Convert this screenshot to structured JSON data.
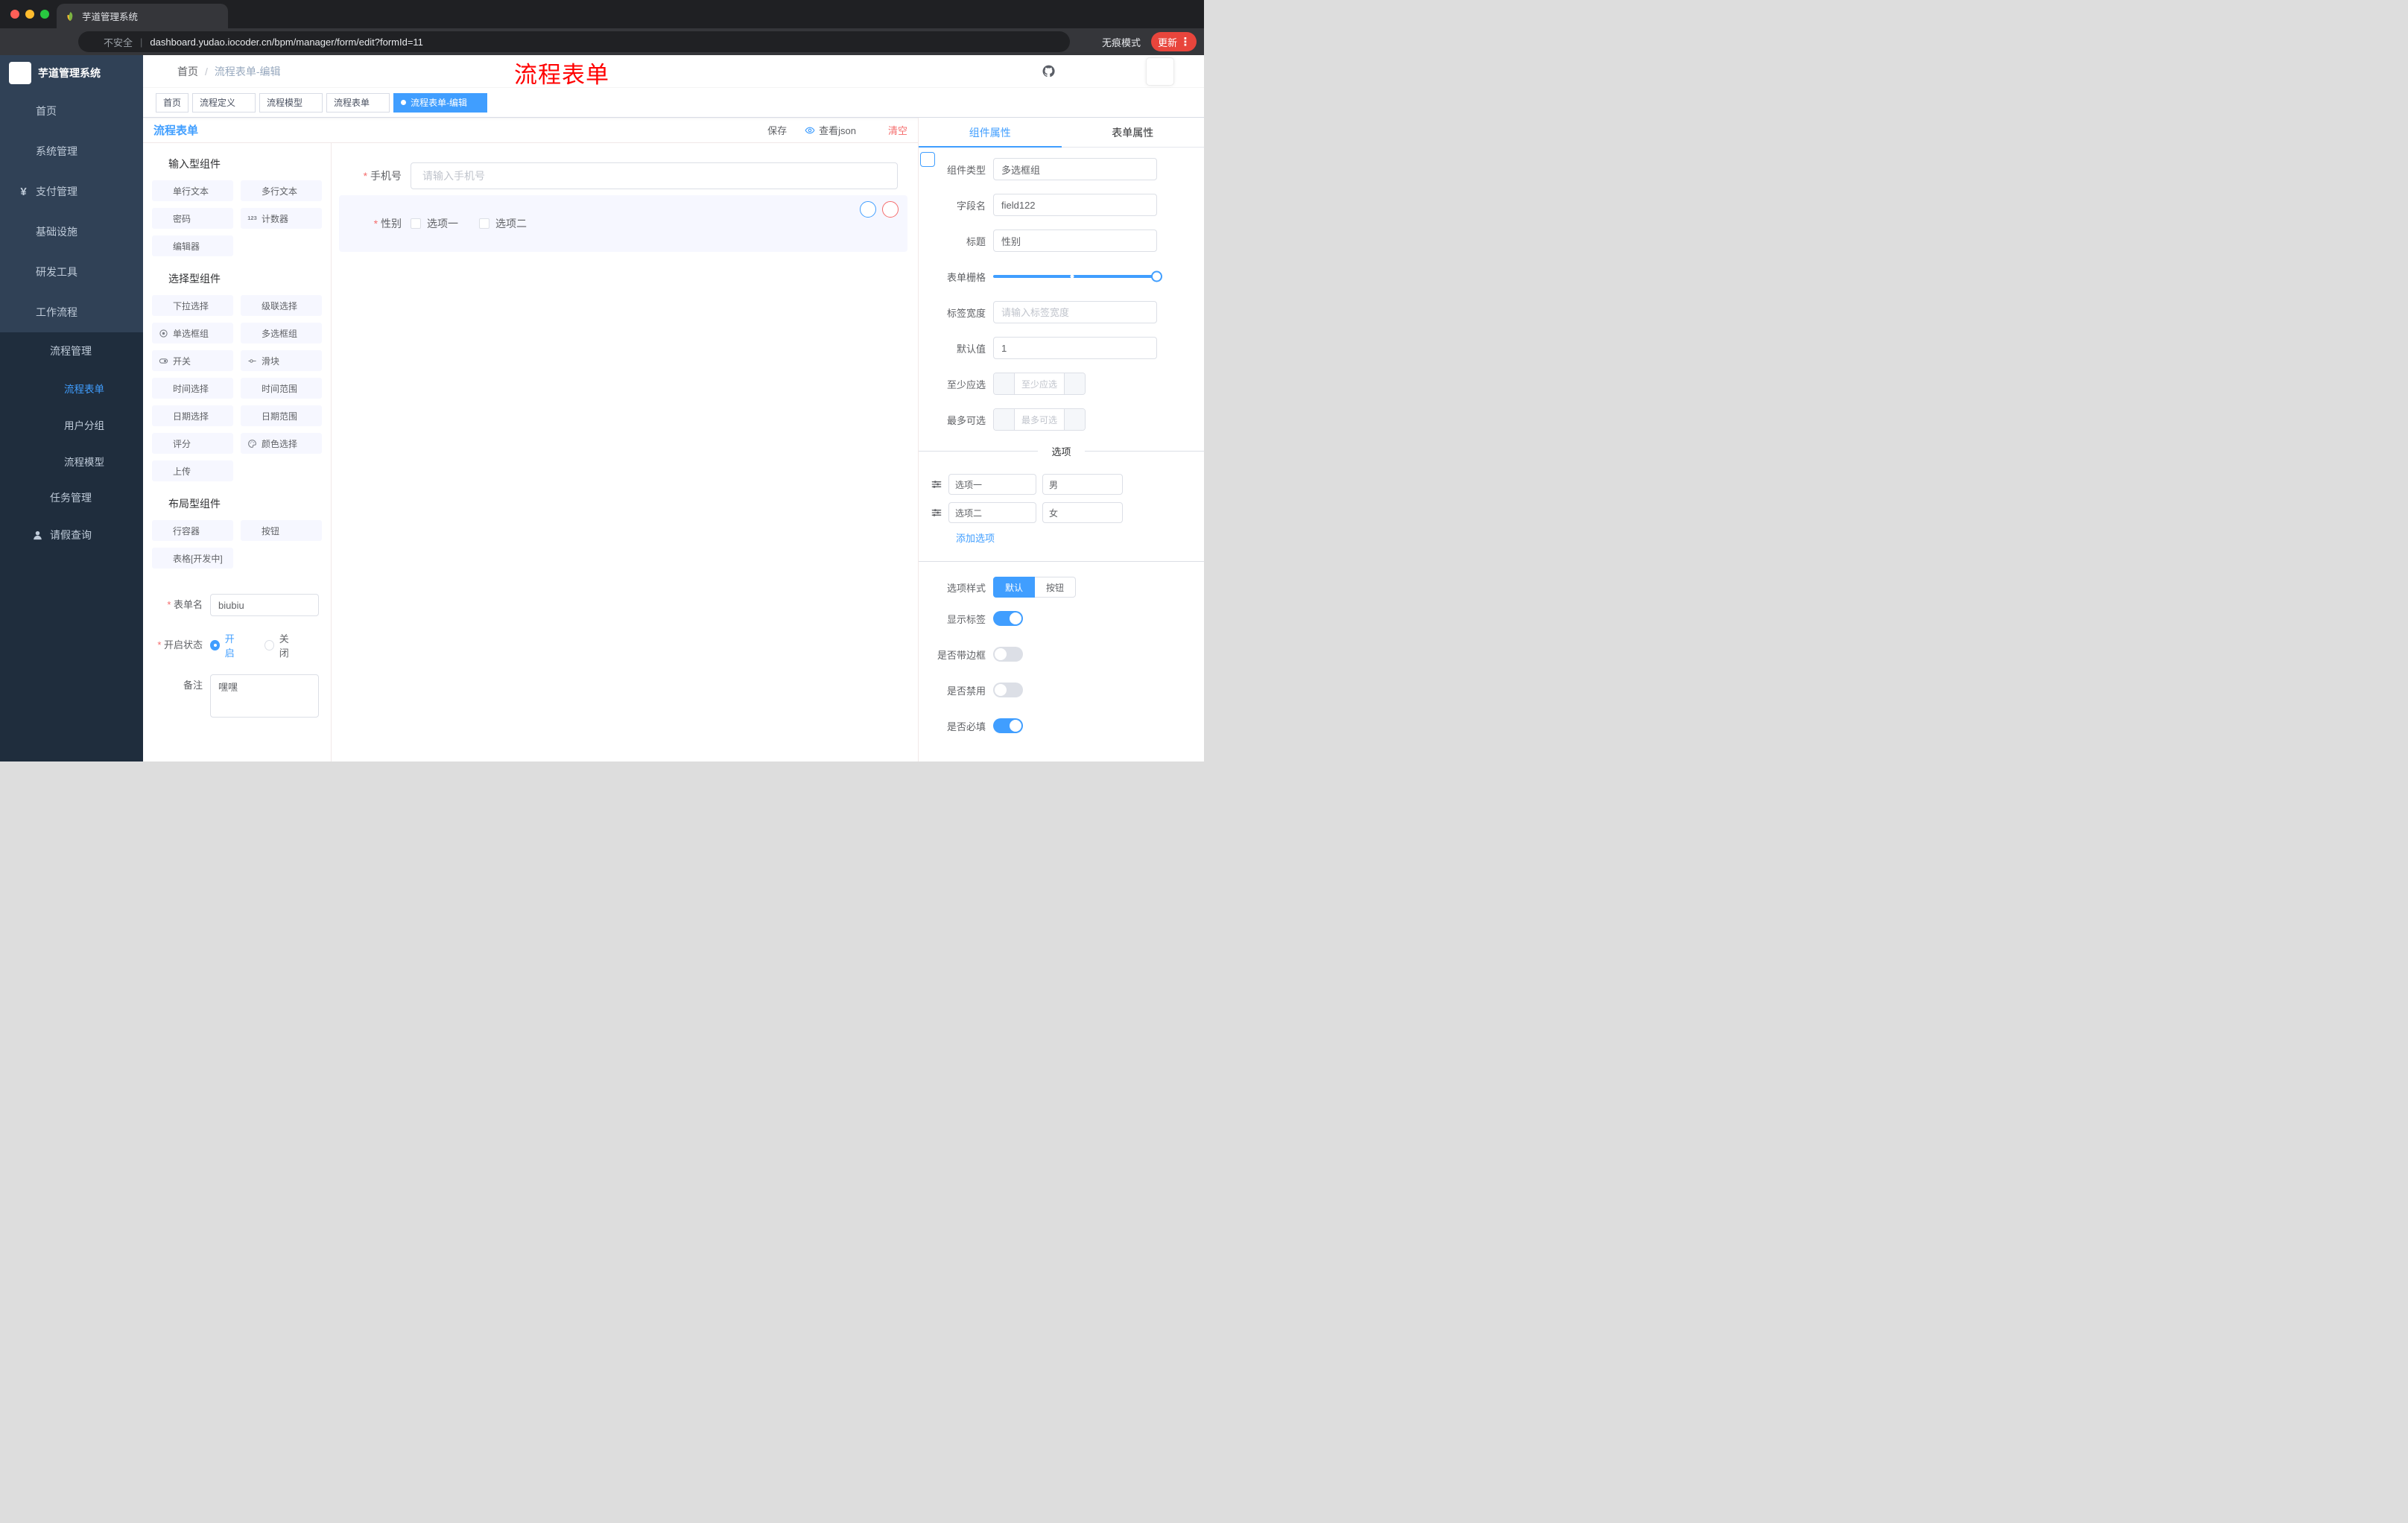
{
  "colors": {
    "primary": "#409eff",
    "danger": "#f56c6c",
    "annotation_red": "#ff0000",
    "update_badge": "#e8453c",
    "sidebar_bg": "#304156",
    "submenu_bg": "#1f2d3d"
  },
  "browser": {
    "tab_title": "芋道管理系统",
    "security_label": "不安全",
    "url": "dashboard.yudao.iocoder.cn/bpm/manager/form/edit?formId=11",
    "incognito_label": "无痕模式",
    "update_label": "更新"
  },
  "sidebar": {
    "logo_title": "芋道管理系统",
    "items": [
      {
        "label": "首页",
        "icon": "home"
      },
      {
        "label": "系统管理",
        "icon": "gear"
      },
      {
        "label": "支付管理",
        "icon": "yen"
      },
      {
        "label": "基础设施",
        "icon": "monitor"
      },
      {
        "label": "研发工具",
        "icon": "tool"
      },
      {
        "label": "工作流程",
        "icon": "flow"
      }
    ],
    "submenu": {
      "group_label": "流程管理",
      "items": [
        {
          "label": "流程表单",
          "icon": "doc",
          "active": true
        },
        {
          "label": "用户分组",
          "icon": "users"
        },
        {
          "label": "流程模型",
          "icon": "send"
        }
      ],
      "task_label": "任务管理",
      "leave_label": "请假查询"
    }
  },
  "header": {
    "breadcrumb_home": "首页",
    "breadcrumb_current": "流程表单-编辑",
    "annotation": "流程表单"
  },
  "tags": [
    {
      "label": "首页"
    },
    {
      "label": "流程定义"
    },
    {
      "label": "流程模型"
    },
    {
      "label": "流程表单"
    },
    {
      "label": "流程表单-编辑",
      "active": true
    }
  ],
  "designer": {
    "title": "流程表单",
    "actions": {
      "save": "保存",
      "view_json": "查看json",
      "clear": "清空"
    },
    "groups": [
      {
        "title": "输入型组件",
        "chips": [
          {
            "label": "单行文本",
            "icon": "input-text"
          },
          {
            "label": "多行文本",
            "icon": "textarea"
          },
          {
            "label": "密码",
            "icon": "password"
          },
          {
            "label": "计数器",
            "icon": "counter"
          },
          {
            "label": "编辑器",
            "icon": "editor"
          }
        ]
      },
      {
        "title": "选择型组件",
        "chips": [
          {
            "label": "下拉选择",
            "icon": "select"
          },
          {
            "label": "级联选择",
            "icon": "cascader"
          },
          {
            "label": "单选框组",
            "icon": "radio-group"
          },
          {
            "label": "多选框组",
            "icon": "checkbox-group"
          },
          {
            "label": "开关",
            "icon": "switch"
          },
          {
            "label": "滑块",
            "icon": "slider"
          },
          {
            "label": "时间选择",
            "icon": "time"
          },
          {
            "label": "时间范围",
            "icon": "time-range"
          },
          {
            "label": "日期选择",
            "icon": "date"
          },
          {
            "label": "日期范围",
            "icon": "date-range"
          },
          {
            "label": "评分",
            "icon": "rate"
          },
          {
            "label": "颜色选择",
            "icon": "color"
          },
          {
            "label": "上传",
            "icon": "upload"
          }
        ]
      },
      {
        "title": "布局型组件",
        "chips": [
          {
            "label": "行容器",
            "icon": "row-container"
          },
          {
            "label": "按钮",
            "icon": "button"
          },
          {
            "label": "表格[开发中]",
            "icon": "table"
          }
        ]
      }
    ],
    "left_form": {
      "name_label": "表单名",
      "name_value": "biubiu",
      "status_label": "开启状态",
      "status_on": "开启",
      "status_off": "关闭",
      "status_selected": "开启",
      "remark_label": "备注",
      "remark_value": "嘿嘿"
    },
    "canvas": {
      "phone_label": "手机号",
      "phone_placeholder": "请输入手机号",
      "gender_label": "性别",
      "gender_options": [
        "选项一",
        "选项二"
      ]
    }
  },
  "props": {
    "tab_component": "组件属性",
    "tab_form": "表单属性",
    "active_tab": "组件属性",
    "component_type_label": "组件类型",
    "component_type_value": "多选框组",
    "field_name_label": "字段名",
    "field_name_value": "field122",
    "title_label": "标题",
    "title_value": "性别",
    "grid_label": "表单栅格",
    "label_width_label": "标签宽度",
    "label_width_placeholder": "请输入标签宽度",
    "default_label": "默认值",
    "default_value": "1",
    "min_label": "至少应选",
    "min_placeholder": "至少应选",
    "max_label": "最多可选",
    "max_placeholder": "最多可选",
    "options_divider": "选项",
    "option_rows": [
      {
        "label": "选项一",
        "value": "男"
      },
      {
        "label": "选项二",
        "value": "女"
      }
    ],
    "add_option": "添加选项",
    "option_style_label": "选项样式",
    "option_style_default": "默认",
    "option_style_button": "按钮",
    "option_style_selected": "默认",
    "toggles": [
      {
        "label": "显示标签",
        "on": true
      },
      {
        "label": "是否带边框",
        "on": false
      },
      {
        "label": "是否禁用",
        "on": false
      },
      {
        "label": "是否必填",
        "on": true
      }
    ]
  }
}
